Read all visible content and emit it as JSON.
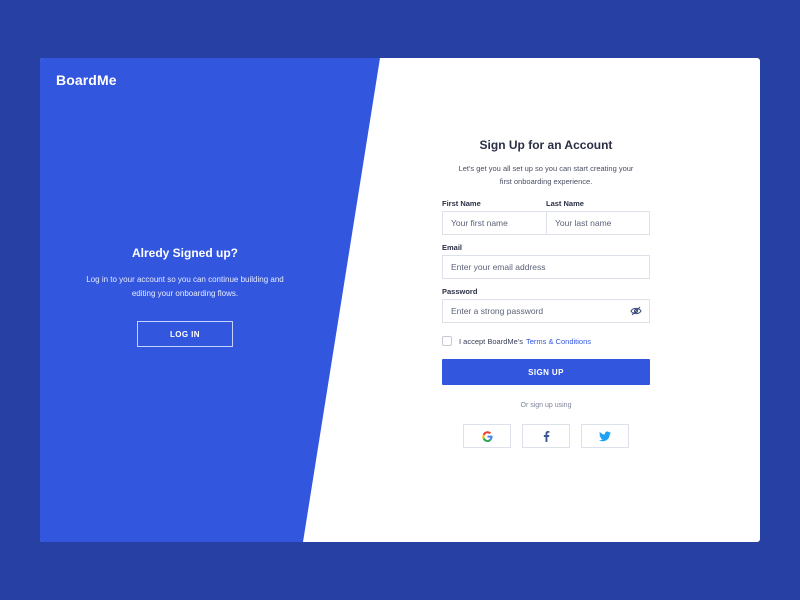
{
  "brand": "BoardMe",
  "left": {
    "title": "Alredy Signed up?",
    "desc_line1": "Log in to your account so you can continue building and",
    "desc_line2": "editing your onboarding flows.",
    "login_label": "LOG IN"
  },
  "form": {
    "title": "Sign Up for an Account",
    "desc_line1": "Let's get you all set up so you can start creating your",
    "desc_line2": "first onboarding experience.",
    "first_name": {
      "label": "First Name",
      "value": "",
      "placeholder": "Your first name"
    },
    "last_name": {
      "label": "Last Name",
      "value": "",
      "placeholder": "Your last name"
    },
    "email": {
      "label": "Email",
      "value": "",
      "placeholder": "Enter your email address"
    },
    "password": {
      "label": "Password",
      "value": "",
      "placeholder": "Enter a strong password"
    },
    "terms_prefix": "I accept BoardMe's",
    "terms_link": "Terms & Conditions",
    "terms_checked": false,
    "signup_label": "SIGN UP",
    "or_text": "Or sign up using"
  },
  "socials": [
    {
      "icon": "google-icon",
      "color": "#4285f4"
    },
    {
      "icon": "facebook-icon",
      "color": "#3b5998"
    },
    {
      "icon": "twitter-icon",
      "color": "#1da1f2"
    }
  ],
  "colors": {
    "background": "#2640a4",
    "accent": "#3356df",
    "card": "#ffffff"
  }
}
